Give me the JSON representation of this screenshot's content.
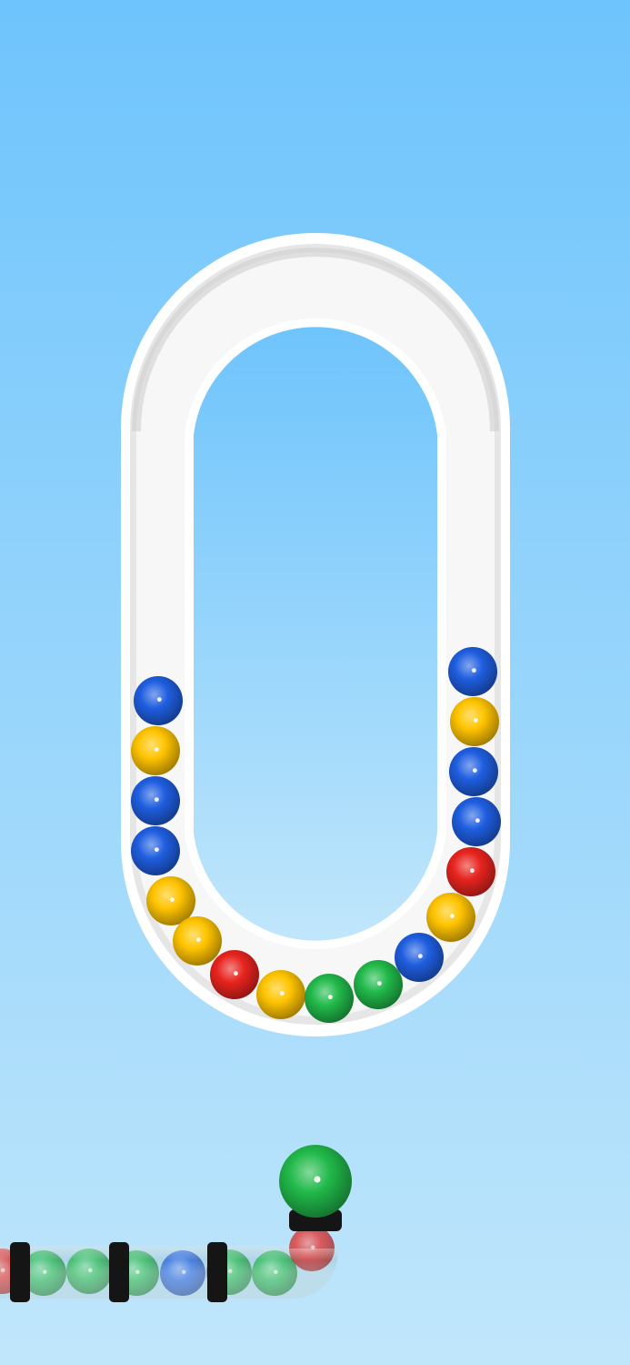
{
  "colors": {
    "sky_top": "#6ec4fc",
    "sky_bottom": "#c0e6fb",
    "track_fill": "#ffffff",
    "track_shadow": "#c9c9c9",
    "tube_tint": "#9ec6d6",
    "collar": "#151515",
    "ball": {
      "blue": "#1f5ee0",
      "yellow": "#ffc400",
      "red": "#e8241f",
      "green": "#21b94a"
    }
  },
  "track": {
    "shape": "stadium-loop",
    "balls_left_column_top_to_bottom": [
      "blue",
      "yellow",
      "blue",
      "blue"
    ],
    "balls_bottom_curve_left_to_right": [
      "yellow",
      "yellow",
      "red",
      "yellow",
      "green",
      "green",
      "blue"
    ],
    "balls_right_column_bottom_to_top": [
      "yellow",
      "red",
      "blue",
      "blue",
      "yellow",
      "blue"
    ]
  },
  "launcher": {
    "shooter_ball": "green",
    "tube_balls_left_to_right": [
      "red",
      "green",
      "green",
      "green",
      "blue",
      "green",
      "green",
      "red"
    ],
    "collar_count": 4
  }
}
